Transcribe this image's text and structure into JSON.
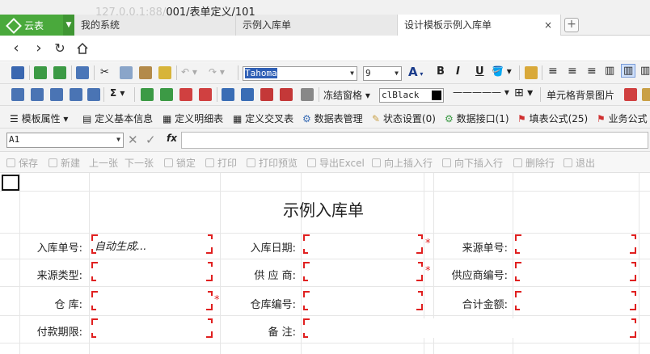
{
  "browser": {
    "app_name": "云表",
    "tabs": [
      {
        "label": "我的系统"
      },
      {
        "label": "示例入库单"
      },
      {
        "label": "设计模板示例入库单",
        "close": "×"
      }
    ],
    "new_tab": "+",
    "url_host": "127.0.0.1:88/",
    "url_path": "001/表单定义/101"
  },
  "toolbar": {
    "font_name": "Tahoma",
    "font_size": "9",
    "bold": "B",
    "italic": "I",
    "underline": "U",
    "freeze_panes": "冻结窗格",
    "color_value": "clBlack",
    "cell_bg_image": "单元格背景图片",
    "sigma": "Σ"
  },
  "menu": {
    "template_props": "模板属性",
    "define_basic_info": "定义基本信息",
    "define_detail_table": "定义明细表",
    "define_cross_table": "定义交叉表",
    "data_table_mgmt": "数据表管理",
    "status_settings": "状态设置(0)",
    "data_interface": "数据接口(1)",
    "fill_formula": "填表公式(25)",
    "business_formula": "业务公式"
  },
  "formula_bar": {
    "cell_ref": "A1",
    "fx": "fx",
    "value": ""
  },
  "actions": [
    {
      "label": "保存"
    },
    {
      "label": "新建"
    },
    {
      "label": "上一张"
    },
    {
      "label": "下一张"
    },
    {
      "label": "锁定"
    },
    {
      "label": "打印"
    },
    {
      "label": "打印预览"
    },
    {
      "label": "导出Excel"
    },
    {
      "label": "向上插入行"
    },
    {
      "label": "向下插入行"
    },
    {
      "label": "删除行"
    },
    {
      "label": "退出"
    }
  ],
  "form": {
    "title": "示例入库单",
    "fields": {
      "receipt_no": {
        "label": "入库单号:",
        "value": "自动生成..."
      },
      "receipt_date": {
        "label": "入库日期:",
        "value": "",
        "required": "*"
      },
      "source_no": {
        "label": "来源单号:",
        "value": ""
      },
      "source_type": {
        "label": "来源类型:",
        "value": ""
      },
      "supplier": {
        "label": "供 应 商:",
        "value": "",
        "required": "*"
      },
      "supplier_no": {
        "label": "供应商编号:",
        "value": ""
      },
      "warehouse": {
        "label": "仓 库:",
        "value": "",
        "required": "*"
      },
      "warehouse_no": {
        "label": "仓库编号:",
        "value": ""
      },
      "total_amount": {
        "label": "合计金额:",
        "value": ""
      },
      "payment_term": {
        "label": "付款期限:",
        "value": ""
      },
      "remark": {
        "label": "备 注:",
        "value": ""
      }
    }
  }
}
